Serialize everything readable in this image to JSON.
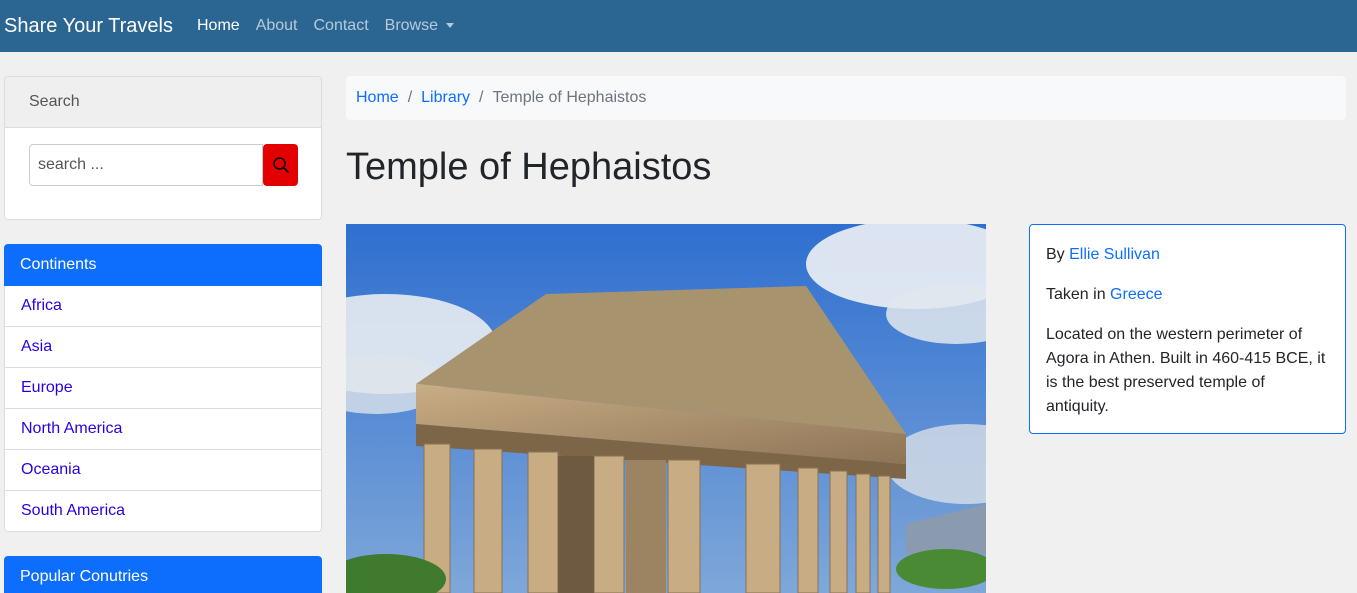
{
  "nav": {
    "brand": "Share Your Travels",
    "items": [
      "Home",
      "About",
      "Contact",
      "Browse"
    ]
  },
  "search": {
    "header": "Search",
    "placeholder": "search ..."
  },
  "continents": {
    "header": "Continents",
    "items": [
      "Africa",
      "Asia",
      "Europe",
      "North America",
      "Oceania",
      "South America"
    ]
  },
  "popular": {
    "header": "Popular Conutries"
  },
  "breadcrumb": {
    "items": [
      "Home",
      "Library"
    ],
    "current": "Temple of Hephaistos"
  },
  "page": {
    "title": "Temple of Hephaistos"
  },
  "info": {
    "by_label": "By",
    "author": "Ellie Sullivan",
    "taken_label": "Taken in",
    "country": "Greece",
    "description": "Located on the western perimeter of Agora in Athen. Built in 460-415 BCE, it is the best preserved temple of antiquity."
  },
  "colors": {
    "navbar": "#2b6693",
    "primary": "#0d6efd",
    "search_button": "#e20000",
    "list_link": "#2a00e0"
  }
}
